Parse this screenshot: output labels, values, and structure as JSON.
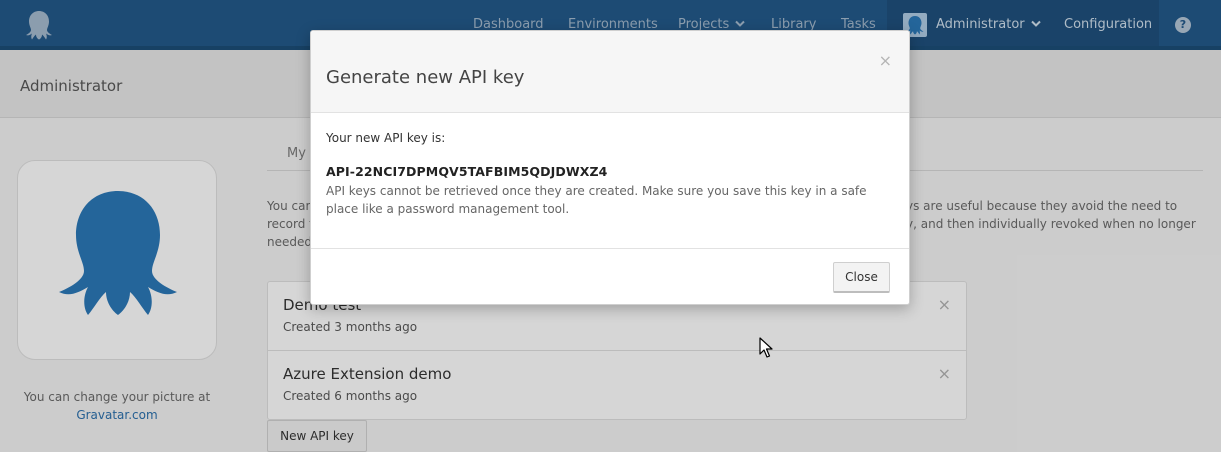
{
  "nav": {
    "items": [
      "Dashboard",
      "Environments",
      "Projects",
      "Library",
      "Tasks"
    ],
    "user_label": "Administrator",
    "configuration_label": "Configuration",
    "help_glyph": "?"
  },
  "page": {
    "title": "Administrator"
  },
  "profile": {
    "change_text": "You can change your picture at",
    "gravatar_link": "Gravatar.com"
  },
  "content": {
    "tab_label": "My",
    "intro_left": [
      "You can",
      "record t",
      "needed"
    ],
    "intro_right": [
      "ys are useful because they avoid the need to",
      "y, and then individually revoked when no longer"
    ],
    "api_keys": [
      {
        "name": "Demo test",
        "created": "Created 3 months ago"
      },
      {
        "name": "Azure Extension demo",
        "created": "Created 6 months ago"
      }
    ],
    "new_key_button": "New API key",
    "remove_glyph": "×"
  },
  "modal": {
    "title": "Generate new API key",
    "close_glyph": "×",
    "intro": "Your new API key is:",
    "api_key": "API-22NCI7DPMQV5TAFBIM5QDJDWXZ4",
    "warning": "API keys cannot be retrieved once they are created. Make sure you save this key in a safe place like a password management tool.",
    "close_button": "Close"
  },
  "colors": {
    "nav_bg": "#225685",
    "brand_blue": "#2a73b0",
    "link": "#2a6ca6"
  },
  "icons": {
    "logo": "octopus-logo-icon",
    "dropdown": "chevron-down-icon",
    "help": "help-circle-icon",
    "cursor": "mouse-pointer-icon"
  }
}
